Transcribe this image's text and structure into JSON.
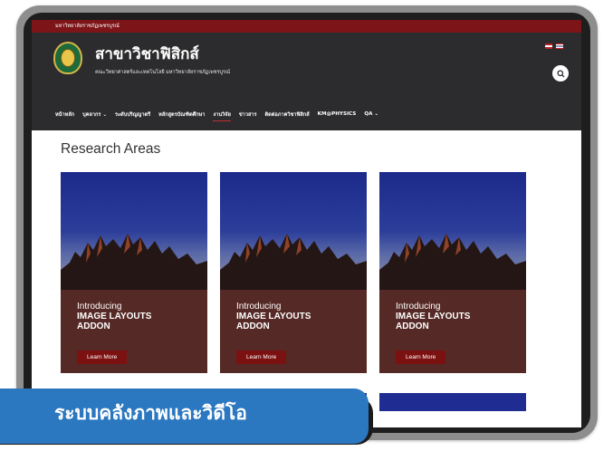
{
  "topbar": {
    "text": "มหาวิทยาลัยราชภัฏเพชรบูรณ์"
  },
  "header": {
    "title": "สาขาวิชาฟิสิกส์",
    "subtitle": "คณะวิทยาศาสตร์และเทคโนโลยี มหาวิทยาลัยราชภัฏเพชรบูรณ์",
    "icons": [
      "university-logo",
      "flag-en-icon",
      "flag-th-icon",
      "search-icon"
    ]
  },
  "nav": [
    {
      "label": "หน้าหลัก"
    },
    {
      "label": "บุคลากร ⌄"
    },
    {
      "label": "ระดับปริญญาตรี"
    },
    {
      "label": "หลักสูตรบัณฑิตศึกษา"
    },
    {
      "label": "งานวิจัย",
      "active": true
    },
    {
      "label": "ข่าวสาร"
    },
    {
      "label": "ติดต่อภาควิชาฟิสิกส์"
    },
    {
      "label": "KM@PHYSICS"
    },
    {
      "label": "QA ⌄"
    }
  ],
  "main": {
    "title": "Research Areas",
    "cards": [
      {
        "intro": "Introducing",
        "heading1": "IMAGE LAYOUTS",
        "heading2": "ADDON",
        "button": "Learn More"
      },
      {
        "intro": "Introducing",
        "heading1": "IMAGE LAYOUTS",
        "heading2": "ADDON",
        "button": "Learn More"
      },
      {
        "intro": "Introducing",
        "heading1": "IMAGE LAYOUTS",
        "heading2": "ADDON",
        "button": "Learn More"
      }
    ]
  },
  "caption": {
    "text": "ระบบคลังภาพและวิดีโอ"
  },
  "colors": {
    "topbar": "#7c1418",
    "header": "#2c2b2d",
    "card_body": "#552925",
    "button": "#7c1111",
    "caption": "#2b77c0"
  }
}
